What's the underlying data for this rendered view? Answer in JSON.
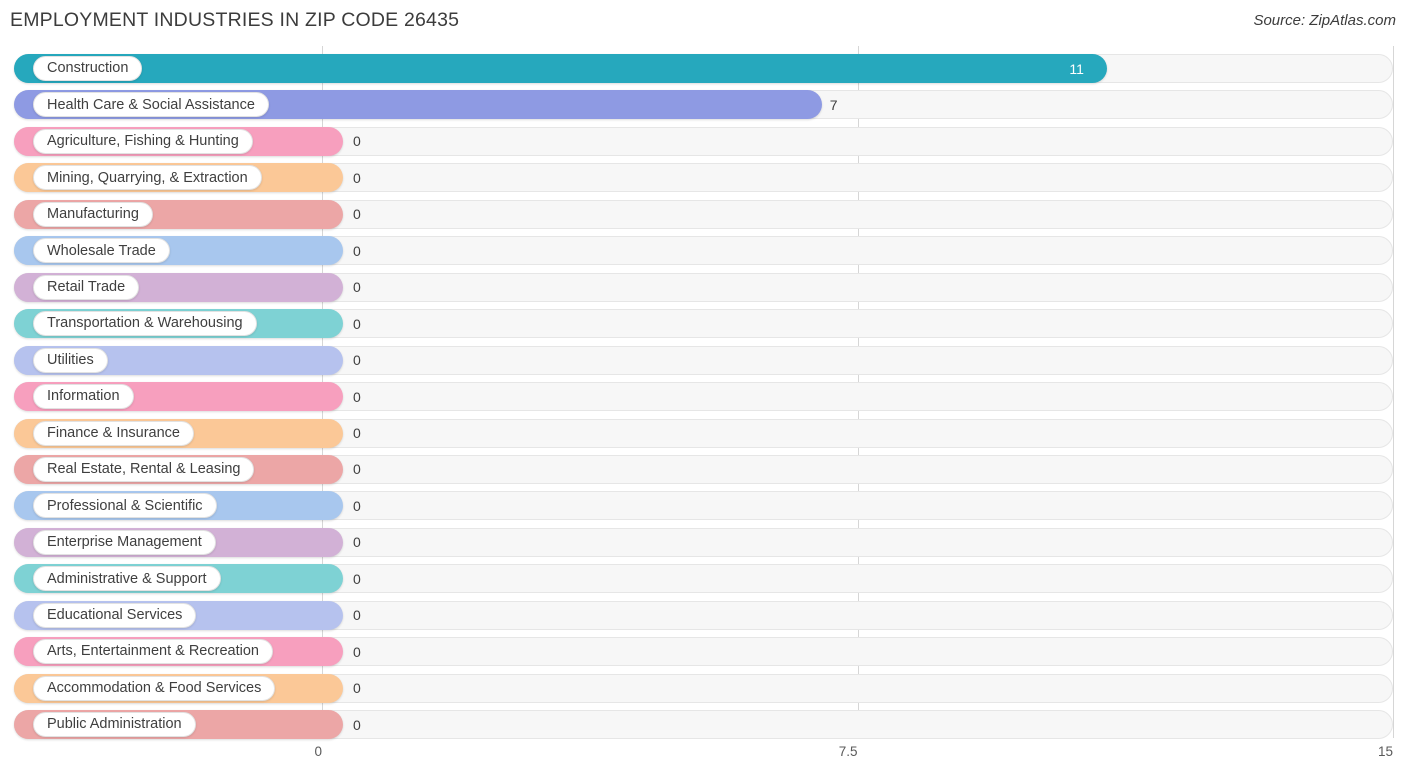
{
  "header": {
    "title": "EMPLOYMENT INDUSTRIES IN ZIP CODE 26435",
    "source": "Source: ZipAtlas.com"
  },
  "axis": {
    "ticks": [
      "0",
      "7.5",
      "15"
    ],
    "tick_values": [
      0,
      7.5,
      15
    ]
  },
  "chart_data": {
    "type": "bar",
    "orientation": "horizontal",
    "title": "EMPLOYMENT INDUSTRIES IN ZIP CODE 26435",
    "xlabel": "",
    "ylabel": "",
    "xlim": [
      0,
      15
    ],
    "xticks": [
      0,
      7.5,
      15
    ],
    "xtick_labels": [
      "0",
      "7.5",
      "15"
    ],
    "grid": true,
    "legend": false,
    "categories": [
      "Construction",
      "Health Care & Social Assistance",
      "Agriculture, Fishing & Hunting",
      "Mining, Quarrying, & Extraction",
      "Manufacturing",
      "Wholesale Trade",
      "Retail Trade",
      "Transportation & Warehousing",
      "Utilities",
      "Information",
      "Finance & Insurance",
      "Real Estate, Rental & Leasing",
      "Professional & Scientific",
      "Enterprise Management",
      "Administrative & Support",
      "Educational Services",
      "Arts, Entertainment & Recreation",
      "Accommodation & Food Services",
      "Public Administration"
    ],
    "values": [
      11,
      7,
      0,
      0,
      0,
      0,
      0,
      0,
      0,
      0,
      0,
      0,
      0,
      0,
      0,
      0,
      0,
      0,
      0
    ],
    "value_labels": [
      "11",
      "7",
      "0",
      "0",
      "0",
      "0",
      "0",
      "0",
      "0",
      "0",
      "0",
      "0",
      "0",
      "0",
      "0",
      "0",
      "0",
      "0",
      "0"
    ],
    "colors": [
      "#26a8bd",
      "#8e9ae3",
      "#f79fbe",
      "#fbc897",
      "#eca6a6",
      "#a8c7ee",
      "#d2b1d6",
      "#7ed2d4",
      "#b6c2ee",
      "#f79fbe",
      "#fbc897",
      "#eca6a6",
      "#a8c7ee",
      "#d2b1d6",
      "#7ed2d4",
      "#b6c2ee",
      "#f79fbe",
      "#fbc897",
      "#eca6a6"
    ]
  }
}
